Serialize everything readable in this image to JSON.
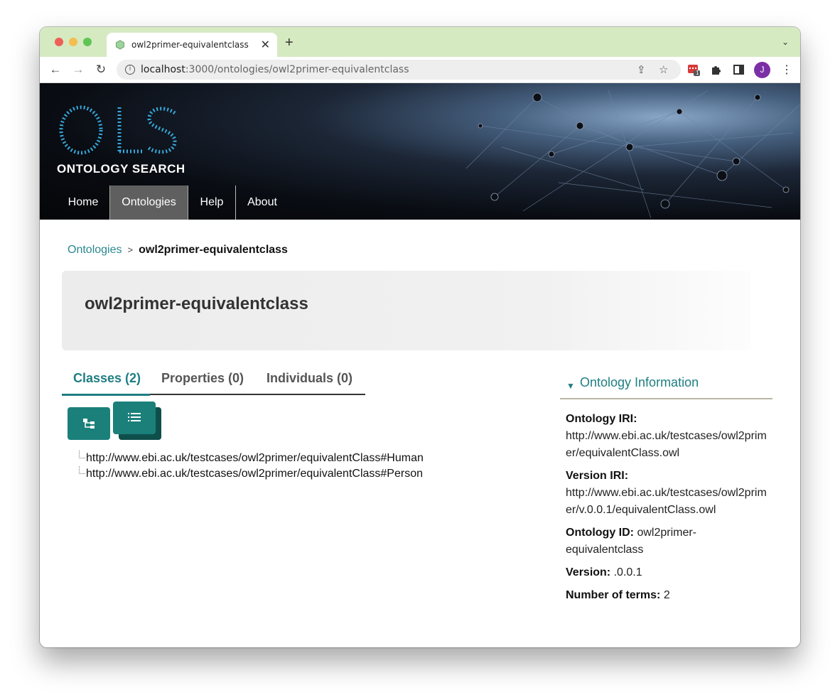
{
  "browser": {
    "tab_title": "owl2primer-equivalentclass",
    "close_glyph": "✕",
    "new_tab_glyph": "+",
    "menu_glyph": "⌄",
    "url_host": "localhost",
    "url_path": ":3000/ontologies/owl2primer-equivalentclass",
    "back_glyph": "←",
    "forward_glyph": "→",
    "reload_glyph": "↻",
    "share_glyph": "⇪",
    "star_glyph": "☆",
    "extension_badge": "1",
    "avatar_letter": "J",
    "kebab_glyph": "⋮"
  },
  "site": {
    "logo_word": "ONTOLOGY SEARCH",
    "nav": [
      "Home",
      "Ontologies",
      "Help",
      "About"
    ]
  },
  "breadcrumb": {
    "link": "Ontologies",
    "separator": ">",
    "current": "owl2primer-equivalentclass"
  },
  "page": {
    "title": "owl2primer-equivalentclass"
  },
  "tabs": [
    "Classes (2)",
    "Properties (0)",
    "Individuals (0)"
  ],
  "tree": [
    "http://www.ebi.ac.uk/testcases/owl2primer/equivalentClass#Human",
    "http://www.ebi.ac.uk/testcases/owl2primer/equivalentClass#Person"
  ],
  "info": {
    "heading": "Ontology Information",
    "caret_glyph": "▼",
    "iri_label": "Ontology IRI:",
    "iri_value": "http://www.ebi.ac.uk/testcases/owl2primer/equivalentClass.owl",
    "version_iri_label": "Version IRI:",
    "version_iri_value": "http://www.ebi.ac.uk/testcases/owl2primer/v.0.0.1/equivalentClass.owl",
    "id_label": "Ontology ID:",
    "id_value": "owl2primer-equivalentclass",
    "version_label": "Version:",
    "version_value": ".0.0.1",
    "terms_label": "Number of terms:",
    "terms_value": "2"
  },
  "colors": {
    "accent": "#1f7e82",
    "button": "#1b7f7a",
    "tabbar": "#d5eac1"
  }
}
